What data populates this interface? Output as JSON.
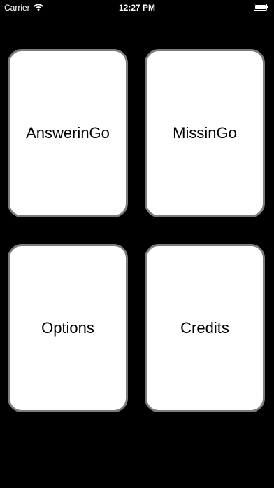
{
  "status_bar": {
    "carrier": "Carrier",
    "time": "12:27 PM",
    "battery_level": 1.0,
    "wifi_icon": "wifi-icon",
    "battery_icon": "battery-icon"
  },
  "menu": {
    "cards": [
      {
        "label": "AnswerinGo"
      },
      {
        "label": "MissinGo"
      },
      {
        "label": "Options"
      },
      {
        "label": "Credits"
      }
    ]
  },
  "colors": {
    "background": "#000000",
    "card_fill": "#ffffff",
    "card_border": "#7c7c7c",
    "text": "#000000",
    "status_text": "#ffffff"
  }
}
